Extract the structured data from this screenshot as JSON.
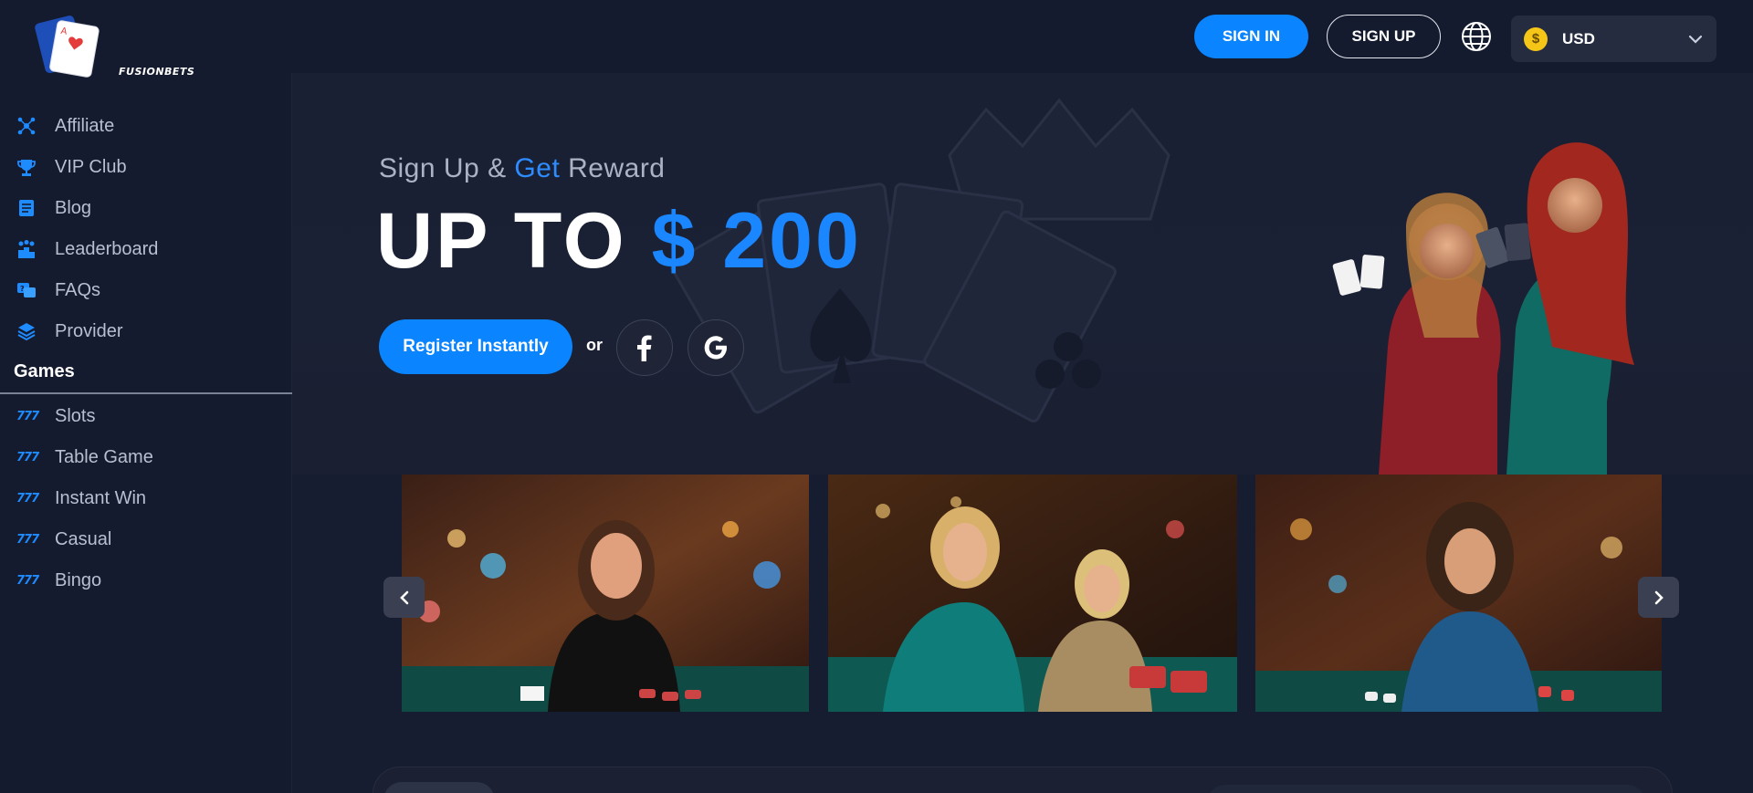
{
  "brand": {
    "name": "FUSIONBETS"
  },
  "header": {
    "signin_label": "SIGN IN",
    "signup_label": "SIGN UP",
    "language_icon": "globe-icon",
    "currency": {
      "symbol": "$",
      "code": "USD"
    }
  },
  "sidebar": {
    "items": [
      {
        "label": "Affiliate",
        "icon": "affiliate-icon"
      },
      {
        "label": "VIP Club",
        "icon": "trophy-icon"
      },
      {
        "label": "Blog",
        "icon": "blog-icon"
      },
      {
        "label": "Leaderboard",
        "icon": "leaderboard-icon"
      },
      {
        "label": "FAQs",
        "icon": "faq-icon"
      },
      {
        "label": "Provider",
        "icon": "provider-icon"
      }
    ],
    "games_header": "Games",
    "games": [
      {
        "label": "Slots",
        "icon": "777"
      },
      {
        "label": "Table Game",
        "icon": "777"
      },
      {
        "label": "Instant Win",
        "icon": "777"
      },
      {
        "label": "Casual",
        "icon": "777"
      },
      {
        "label": "Bingo",
        "icon": "777"
      }
    ]
  },
  "hero": {
    "sub_prefix": "Sign Up & ",
    "sub_highlight": "Get",
    "sub_suffix": " Reward",
    "main_prefix": "UP TO ",
    "main_amount": "$ 200",
    "register_label": "Register Instantly",
    "or_label": "or"
  },
  "colors": {
    "accent": "#0a84ff",
    "background": "#141a2e",
    "coin": "#f5c518"
  }
}
